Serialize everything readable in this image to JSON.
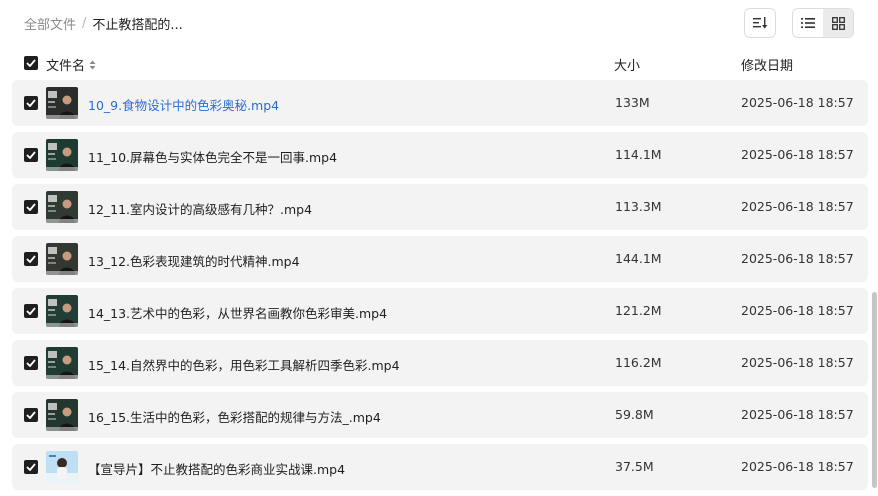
{
  "breadcrumb": {
    "root": "全部文件",
    "separator": "/",
    "current": "不止教搭配的..."
  },
  "header": {
    "name": "文件名",
    "size": "大小",
    "date": "修改日期"
  },
  "files": [
    {
      "name": "10_9.食物设计中的色彩奥秘.mp4",
      "size": "133M",
      "date": "2025-06-18 18:57",
      "thumb": "video-thumbnail"
    },
    {
      "name": "11_10.屏幕色与实体色完全不是一回事.mp4",
      "size": "114.1M",
      "date": "2025-06-18 18:57",
      "thumb": "video-thumbnail"
    },
    {
      "name": "12_11.室内设计的高级感有几种？.mp4",
      "size": "113.3M",
      "date": "2025-06-18 18:57",
      "thumb": "video-thumbnail"
    },
    {
      "name": "13_12.色彩表现建筑的时代精神.mp4",
      "size": "144.1M",
      "date": "2025-06-18 18:57",
      "thumb": "video-thumbnail"
    },
    {
      "name": "14_13.艺术中的色彩，从世界名画教你色彩审美.mp4",
      "size": "121.2M",
      "date": "2025-06-18 18:57",
      "thumb": "video-thumbnail"
    },
    {
      "name": "15_14.自然界中的色彩，用色彩工具解析四季色彩.mp4",
      "size": "116.2M",
      "date": "2025-06-18 18:57",
      "thumb": "video-thumbnail"
    },
    {
      "name": "16_15.生活中的色彩，色彩搭配的规律与方法_.mp4",
      "size": "59.8M",
      "date": "2025-06-18 18:57",
      "thumb": "video-thumbnail"
    },
    {
      "name": "【宣导片】不止教搭配的色彩商业实战课.mp4",
      "size": "37.5M",
      "date": "2025-06-18 18:57",
      "thumb": "promo-thumbnail"
    }
  ],
  "colors": {
    "row_bg": "#f3f3f3",
    "link": "#2b6cd4",
    "checkbox": "#1f1f1f"
  }
}
